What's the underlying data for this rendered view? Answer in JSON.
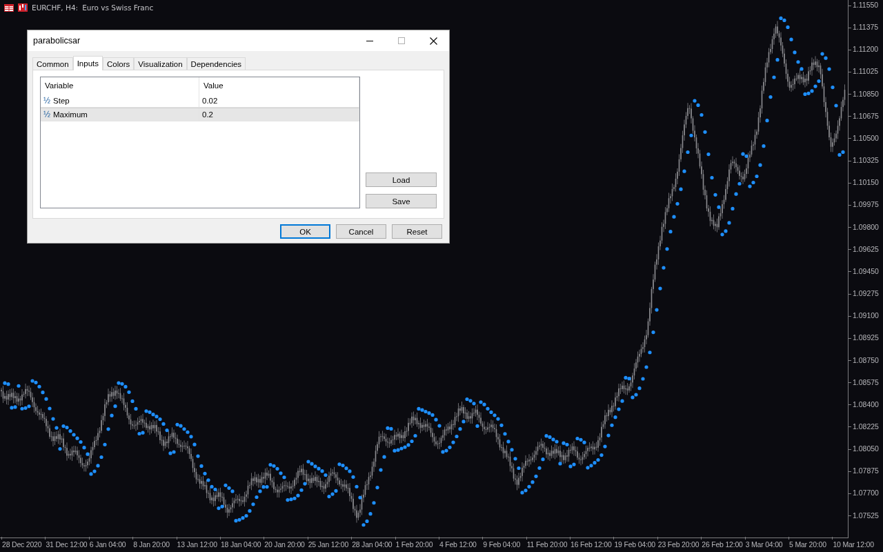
{
  "chart_header": {
    "symbol": "EURCHF, H4:",
    "description": "Euro vs Swiss Franc"
  },
  "dialog": {
    "title": "parabolicsar",
    "tabs": [
      {
        "label": "Common",
        "selected": false
      },
      {
        "label": "Inputs",
        "selected": true
      },
      {
        "label": "Colors",
        "selected": false
      },
      {
        "label": "Visualization",
        "selected": false
      },
      {
        "label": "Dependencies",
        "selected": false
      }
    ],
    "table": {
      "columns": [
        "Variable",
        "Value"
      ],
      "rows": [
        {
          "type_glyph": "½",
          "variable": "Step",
          "value": "0.02",
          "selected": false
        },
        {
          "type_glyph": "½",
          "variable": "Maximum",
          "value": "0.2",
          "selected": true
        }
      ]
    },
    "side_buttons": [
      "Load",
      "Save"
    ],
    "buttons": [
      {
        "label": "OK",
        "default": true
      },
      {
        "label": "Cancel",
        "default": false
      },
      {
        "label": "Reset",
        "default": false
      }
    ]
  },
  "price_axis": [
    "1.11550",
    "1.11375",
    "1.11200",
    "1.11025",
    "1.10850",
    "1.10675",
    "1.10500",
    "1.10325",
    "1.10150",
    "1.09975",
    "1.09800",
    "1.09625",
    "1.09450",
    "1.09275",
    "1.09100",
    "1.08925",
    "1.08750",
    "1.08575",
    "1.08400",
    "1.08225",
    "1.08050",
    "1.07875",
    "1.07700",
    "1.07525"
  ],
  "time_axis": [
    "28 Dec 2020",
    "31 Dec 12:00",
    "6 Jan 04:00",
    "8 Jan 20:00",
    "13 Jan 12:00",
    "18 Jan 04:00",
    "20 Jan 20:00",
    "25 Jan 12:00",
    "28 Jan 04:00",
    "1 Feb 20:00",
    "4 Feb 12:00",
    "9 Feb 04:00",
    "11 Feb 20:00",
    "16 Feb 12:00",
    "19 Feb 04:00",
    "23 Feb 20:00",
    "26 Feb 12:00",
    "3 Mar 04:00",
    "5 Mar 20:00",
    "10 Mar 12:00"
  ]
}
